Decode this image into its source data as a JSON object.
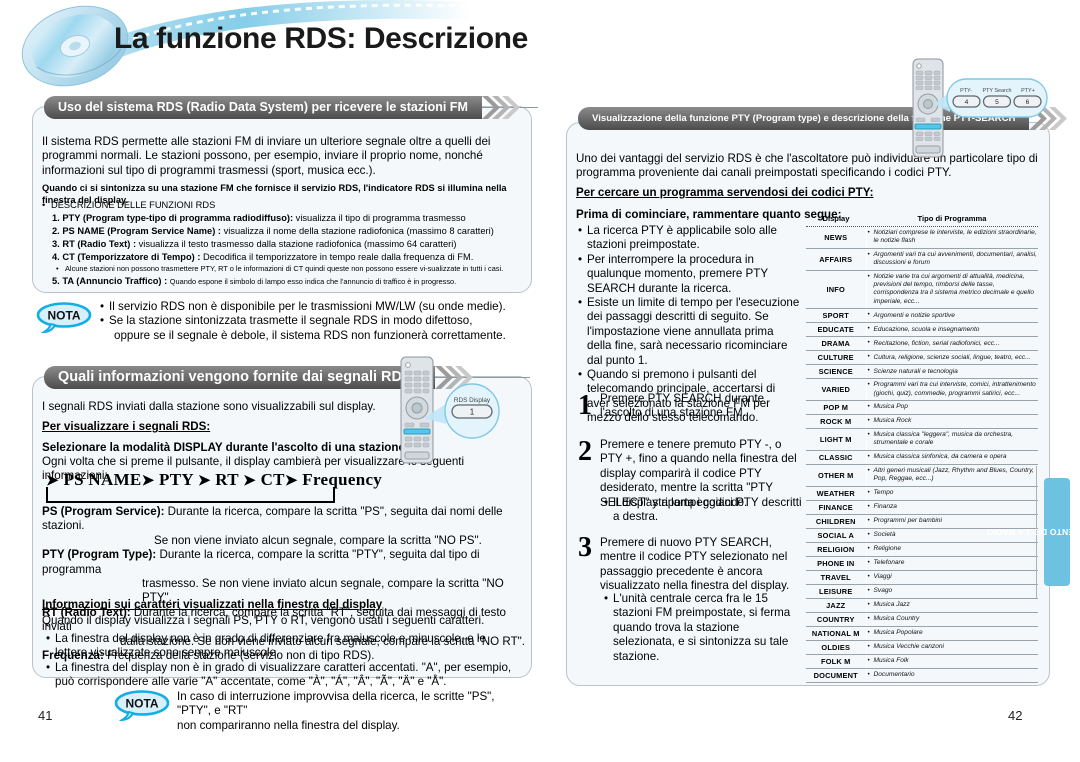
{
  "page": {
    "title": "La funzione RDS: Descrizione",
    "left_page_number": "41",
    "right_page_number": "42",
    "side_tab": "FUNZIONAMENTO DELLA RADIO",
    "accent_color": "#6cc2e0",
    "banner_color": "#5a5a5a",
    "panel_bg": "#f4f8fb"
  },
  "left": {
    "section1": {
      "banner": "Uso del sistema RDS (Radio Data System) per ricevere le stazioni FM",
      "intro": "Il sistema RDS permette alle stazioni FM di inviare un ulteriore segnale oltre a quelli dei programmi normali. Le stazioni possono, per esempio, inviare il proprio nome, nonché informazioni sul tipo di programmi trasmessi (sport, musica ecc.).",
      "bold_note": "Quando ci si sintonizza su una stazione FM che fornisce il servizio RDS, l'indicatore RDS si illumina nella finestra del display.",
      "list_heading": "DESCRIZIONE DELLE FUNZIONI RDS",
      "items": [
        {
          "num": "1.",
          "term": "PTY (Program type-tipo di programma radiodiffuso):",
          "desc": "visualizza il tipo di programma trasmesso"
        },
        {
          "num": "2.",
          "term": "PS NAME (Program Service Name) :",
          "desc": "visualizza il nome della stazione radiofonica (massimo 8 caratteri)"
        },
        {
          "num": "3.",
          "term": "RT (Radio Text) :",
          "desc": "visualizza il testo trasmesso dalla stazione radiofonica (massimo 64 caratteri)"
        },
        {
          "num": "4.",
          "term": "CT (Temporizzatore di Tempo) :",
          "desc": "Decodifica il temporizzatore in tempo reale dalla frequenza di FM."
        }
      ],
      "sub_note": "Alcune stazioni non possono trasmettere PTY, RT o le informazioni di CT quindi queste non possono essere vi-sualizzate in tutti i casi.",
      "item5": {
        "num": "5.",
        "term": "TA (Annuncio Traffico) :",
        "desc": "Quando espone il simbolo di lampo esso indica che l'annuncio di traffico è in progresso."
      },
      "nota_label": "NOTA",
      "nota_lines": [
        "Il servizio RDS non è disponibile per le trasmissioni MW/LW (su onde medie).",
        "Se la stazione sintonizzata trasmette il segnale RDS in modo difettoso,",
        "oppure se il segnale è debole, il sistema RDS non funzionerà correttamente."
      ]
    },
    "section2": {
      "banner": "Quali informazioni vengono fornite dai segnali RDS?",
      "intro": "I segnali RDS inviati dalla stazione sono visualizzabili sul display.",
      "heading": "Per visualizzare i segnali RDS:",
      "bold_line": "Selezionare la modalità DISPLAY durante l'ascolto di una stazione FM.",
      "sub_line": "Ogni volta che si preme il pulsante,  il display cambierà per visualizzare le seguenti informazioni:",
      "flow": [
        "PS NAME",
        "PTY",
        "RT",
        "CT",
        "Frequency"
      ],
      "defs": [
        {
          "term": "PS (Program Service):",
          "l1": "Durante la ricerca, compare la scritta \"PS\", seguita dai nomi delle stazioni.",
          "l2": "Se non viene inviato alcun segnale, compare la scritta \"NO PS\"."
        },
        {
          "term": "PTY (Program Type):",
          "l1": "Durante la ricerca, compare la scritta \"PTY\", seguita dal tipo di programma",
          "l2": "trasmesso. Se non viene inviato alcun segnale, compare la scritta \"NO PTY\"."
        },
        {
          "term": "RT (Radio Text):",
          "l1": "Durante la ricerca, compare la scritta \"RT\", seguita dai messaggi di testo inviati",
          "l2": "dalla stazione. Se non viene inviato alcun segnale, compare la scritta \"NO RT\"."
        },
        {
          "term": "Frequenza:",
          "l1": "Frequenza della stazione (servizio non di tipo RDS).",
          "l2": ""
        }
      ],
      "chars_heading": "Informazioni sui caratteri visualizzati nella finestra del display",
      "chars_intro": "Quando il display visualizza i segnali PS, PTY o RT, vengono usati i seguenti caratteri.",
      "chars_bullets": [
        "La finestra del display non è in grado di differenziare fra maiuscole e minuscole, e le lettere visualizzate sono sempre maiuscole.",
        "La finestra del display non è in grado di visualizzare caratteri accentati. \"A\", per esempio, può corrispondere alle varie \"A\" accentate, come \"À\", \"Á\", \"Â\", \"Ã\", \"Ä\" e \"Å\"."
      ],
      "nota_label": "NOTA",
      "nota_lines": [
        "In caso di interruzione improvvisa della ricerca, le scritte \"PS\", \"PTY\", e \"RT\"",
        "non compariranno nella finestra del display."
      ],
      "callout": {
        "label": "RDS Display",
        "button": "1"
      }
    }
  },
  "right": {
    "banner": "Visualizzazione della funzione PTY (Program type) e descrizione della funzione PTY-SEARCH",
    "intro": "Uno dei vantaggi del servizio RDS è che l'ascoltatore può individuare un particolare tipo di programma proveniente dai canali preimpostati specificando i codici PTY.",
    "heading": "Per cercare un programma servendosi dei codici PTY:",
    "subheading": "Prima di cominciare, rammentare quanto segue:",
    "bullets": [
      "La ricerca PTY è applicabile solo alle stazioni preimpostate.",
      "Per interrompere la procedura in qualunque momento, premere PTY SEARCH durante la ricerca.",
      "Esiste un limite di tempo per l'esecuzione dei passaggi descritti di seguito. Se l'impostazione viene annullata prima della fine, sarà necessario ricominciare dal punto 1.",
      "Quando si premono i pulsanti del telecomando principale, accertarsi di aver selezionato la stazione FM per mezzo dello stesso telecomando."
    ],
    "steps": [
      {
        "n": "1",
        "text": "Premere PTY SEARCH durante l'ascolto di una stazione FM.",
        "sub": []
      },
      {
        "n": "2",
        "text": "Premere e tenere premuto PTY -, o PTY +, fino a quando nella finestra del display comparirà il codice PTY desiderato, mentre la scritta \"PTY SELECT\" sta lampeggiando.",
        "sub": [
          "Il display riporta i codici PTY descritti a destra."
        ]
      },
      {
        "n": "3",
        "text": "Premere di nuovo PTY SEARCH, mentre il codice PTY selezionato nel passaggio precedente è ancora visualizzato nella finestra del display.",
        "sub": [
          "L'unità centrale cerca fra le 15 stazioni FM preimpostate, si ferma quando trova la stazione selezionata, e si sintonizza su tale stazione."
        ]
      }
    ],
    "callout": {
      "labels": [
        "PTY-",
        "PTY Search",
        "PTY+"
      ],
      "buttons": [
        "4",
        "5",
        "6"
      ]
    },
    "pty_table": {
      "headers": [
        "Display",
        "Tipo di Programma"
      ],
      "rows": [
        {
          "display": "NEWS",
          "desc": "Notiziari comprese le interviste, le edizioni straordinarie, le notizie flash"
        },
        {
          "display": "AFFAIRS",
          "desc": "Argomenti vari tra cui avvenimenti, documentari, analisi, discussioni e forum"
        },
        {
          "display": "INFO",
          "desc": "Notizie varie tra cui argomenti di attualità, medicina, previsioni del tempo, rimborsi delle tasse, corrispondenza tra il sistema  metrico decimale e quello imperiale, ecc..."
        },
        {
          "display": "SPORT",
          "desc": "Argomenti e notizie sportive"
        },
        {
          "display": "EDUCATE",
          "desc": "Educazione, scuola e insegnamento"
        },
        {
          "display": "DRAMA",
          "desc": "Recitazione, fiction, serial radiofonici, ecc..."
        },
        {
          "display": "CULTURE",
          "desc": "Cultura, religione, scienze sociali, lingue, teatro, ecc..."
        },
        {
          "display": "SCIENCE",
          "desc": "Scienze naturali e tecnologia"
        },
        {
          "display": "VARIED",
          "desc": "Programmi vari tra cui interviste, comici, intrattenimento (giochi, quiz), commedie, programmi satirici, ecc..."
        },
        {
          "display": "POP M",
          "desc": "Musica Pop"
        },
        {
          "display": "ROCK M",
          "desc": "Musica Rock"
        },
        {
          "display": "LIGHT M",
          "desc": "Musica classica \"leggera\", musica da orchestra, strumentale e corale"
        },
        {
          "display": "CLASSIC",
          "desc": "Musica classica sinfonica, da camera e opera"
        },
        {
          "display": "OTHER M",
          "desc": "Altri generi musicali (Jazz, Rhythm and Blues, Country, Pop, Reggae, ecc...)"
        },
        {
          "display": "WEATHER",
          "desc": "Tempo"
        },
        {
          "display": "FINANCE",
          "desc": "Finanza"
        },
        {
          "display": "CHILDREN",
          "desc": "Programmi per bambini"
        },
        {
          "display": "SOCIAL A",
          "desc": "Società"
        },
        {
          "display": "RELIGION",
          "desc": "Religione"
        },
        {
          "display": "PHONE IN",
          "desc": "Telefonare"
        },
        {
          "display": "TRAVEL",
          "desc": "Viaggi"
        },
        {
          "display": "LEISURE",
          "desc": "Svago"
        },
        {
          "display": "JAZZ",
          "desc": "Musica Jazz"
        },
        {
          "display": "COUNTRY",
          "desc": "Musica Country"
        },
        {
          "display": "NATIONAL M",
          "desc": "Musica Popolare"
        },
        {
          "display": "OLDIES",
          "desc": "Musica Vecchie canzoni"
        },
        {
          "display": "FOLK M",
          "desc": "Musica Folk"
        },
        {
          "display": "DOCUMENT",
          "desc": "Documentario"
        }
      ]
    }
  }
}
